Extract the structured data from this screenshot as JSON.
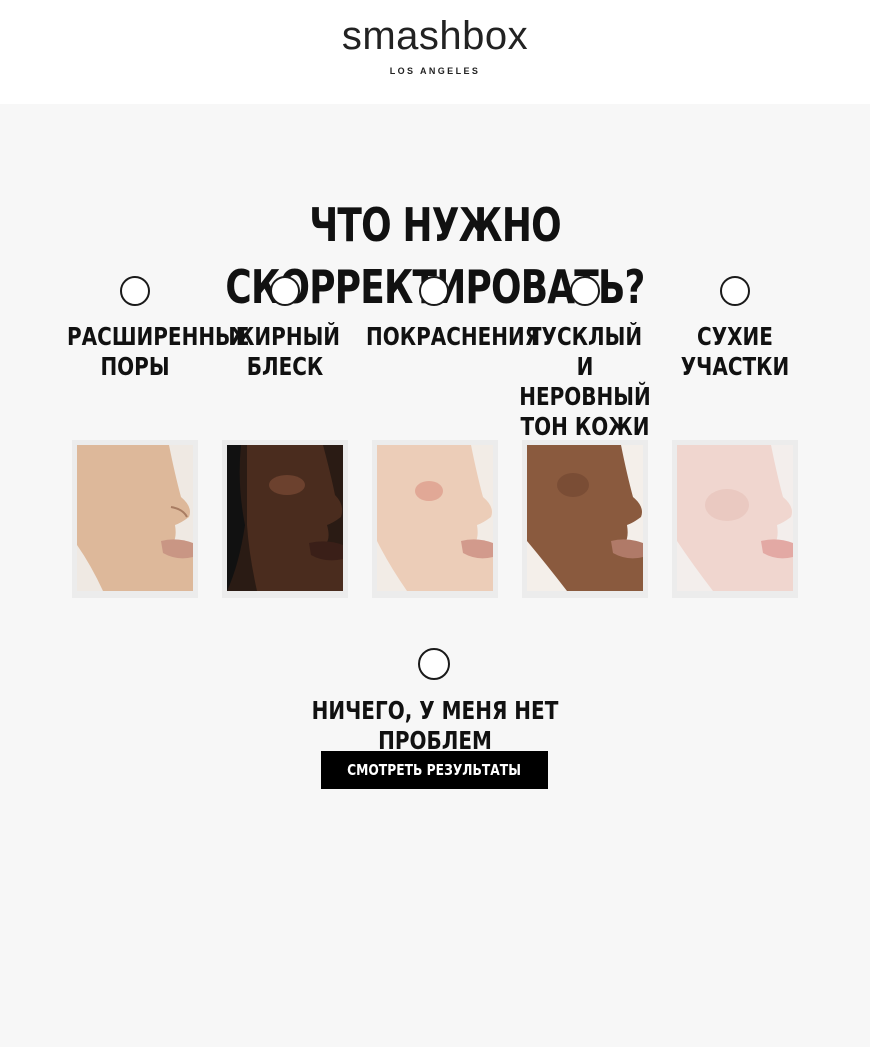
{
  "brand": {
    "name": "smashbox",
    "tagline": "LOS ANGELES"
  },
  "quiz": {
    "question": "ЧТО НУЖНО СКОРРЕКТИРОВАТЬ?",
    "options": [
      {
        "lines": [
          "РАСШИРЕННЫЕ",
          "ПОРЫ"
        ],
        "image": "face-enlarged-pores"
      },
      {
        "lines": [
          "ЖИРНЫЙ",
          "БЛЕСК"
        ],
        "image": "face-oily-shine"
      },
      {
        "lines": [
          "ПОКРАСНЕНИЯ"
        ],
        "image": "face-redness"
      },
      {
        "lines": [
          "ТУСКЛЫЙ",
          "И НЕРОВНЫЙ",
          "ТОН КОЖИ"
        ],
        "image": "face-dull-uneven-tone"
      },
      {
        "lines": [
          "СУХИЕ",
          "УЧАСТКИ"
        ],
        "image": "face-dry-patches"
      }
    ],
    "none_option": "НИЧЕГО, У МЕНЯ НЕТ ПРОБЛЕМ",
    "submit_label": "СМОТРЕТЬ РЕЗУЛЬТАТЫ"
  },
  "colors": {
    "background": "#f7f7f7",
    "header": "#ffffff",
    "button": "#000000",
    "text": "#111111"
  }
}
